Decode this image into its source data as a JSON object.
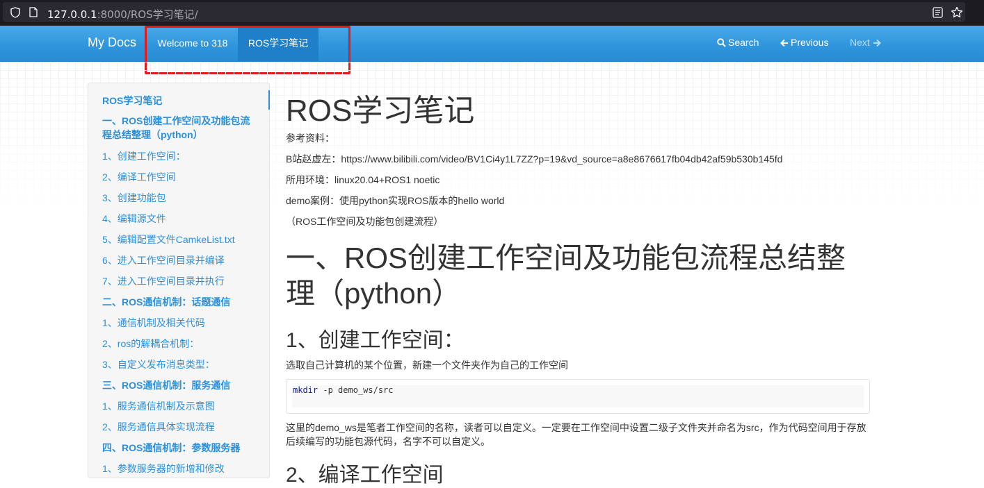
{
  "browser": {
    "url_host": "127.0.0.1",
    "url_rest": ":8000/ROS学习笔记/"
  },
  "navbar": {
    "brand": "My Docs",
    "tabs": [
      {
        "label": "Welcome to 318",
        "active": false
      },
      {
        "label": "ROS学习笔记",
        "active": true
      }
    ],
    "search": "Search",
    "previous": "Previous",
    "next": "Next"
  },
  "sidebar": {
    "items": [
      {
        "label": "ROS学习笔记",
        "level": 1
      },
      {
        "label": "一、ROS创建工作空间及功能包流程总结整理（python）",
        "level": 1
      },
      {
        "label": "1、创建工作空间：",
        "level": 2
      },
      {
        "label": "2、编译工作空间",
        "level": 2
      },
      {
        "label": "3、创建功能包",
        "level": 2
      },
      {
        "label": "4、编辑源文件",
        "level": 2
      },
      {
        "label": "5、编辑配置文件CamkeList.txt",
        "level": 2
      },
      {
        "label": "6、进入工作空间目录并编译",
        "level": 2
      },
      {
        "label": "7、进入工作空间目录并执行",
        "level": 2
      },
      {
        "label": "二、ROS通信机制：话题通信",
        "level": 1
      },
      {
        "label": "1、通信机制及相关代码",
        "level": 2
      },
      {
        "label": "2、ros的解耦合机制：",
        "level": 2
      },
      {
        "label": "3、自定义发布消息类型：",
        "level": 2
      },
      {
        "label": "三、ROS通信机制：服务通信",
        "level": 1
      },
      {
        "label": "1、服务通信机制及示意图",
        "level": 2
      },
      {
        "label": "2、服务通信具体实现流程",
        "level": 2
      },
      {
        "label": "四、ROS通信机制：参数服务器",
        "level": 1
      },
      {
        "label": "1、参数服务器的新增和修改",
        "level": 2
      }
    ]
  },
  "content": {
    "title": "ROS学习笔记",
    "ref_label": "参考资料：",
    "ref_link": "B站赵虚左：https://www.bilibili.com/video/BV1Ci4y1L7ZZ?p=19&vd_source=a8e8676617fb04db42af59b530b145fd",
    "env": "所用环境：linux20.04+ROS1 noetic",
    "demo": "demo案例：使用python实现ROS版本的hello world",
    "demo_sub": "（ROS工作空间及功能包创建流程）",
    "section1_title": "一、ROS创建工作空间及功能包流程总结整理（python）",
    "sub1_title": "1、创建工作空间：",
    "sub1_desc": "选取自己计算机的某个位置，新建一个文件夹作为自己的工作空间",
    "code_cmd": "mkdir",
    "code_args": " -p demo_ws/src",
    "explain": "这里的demo_ws是笔者工作空间的名称，读者可以自定义。一定要在工作空间中设置二级子文件夹并命名为src，作为代码空间用于存放后续编写的功能包源代码，名字不可以自定义。",
    "sub2_title": "2、编译工作空间"
  }
}
